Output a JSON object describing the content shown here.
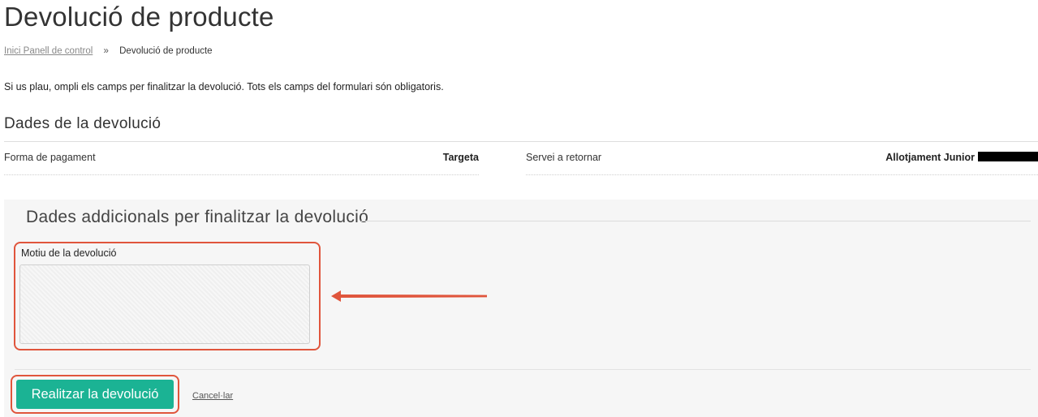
{
  "page": {
    "title": "Devolució de producte",
    "breadcrumb": {
      "home_link": "Inici Panell de control",
      "separator": "»",
      "current": "Devolució de producte"
    },
    "intro": "Si us plau, ompli els camps per finalitzar la devolució. Tots els camps del formulari són obligatoris."
  },
  "summary": {
    "title": "Dades de la devolució",
    "payment_label": "Forma de pagament",
    "payment_value": "Targeta",
    "service_label": "Servei a retornar",
    "service_value": "Allotjament Junior"
  },
  "form": {
    "legend": "Dades addicionals per finalitzar la devolució",
    "reason_label": "Motiu de la devolució",
    "reason_value": "",
    "submit_label": "Realitzar la devolució",
    "cancel_label": "Cancel·lar"
  },
  "colors": {
    "accent": "#1bb394",
    "annotation": "#e0553c"
  }
}
